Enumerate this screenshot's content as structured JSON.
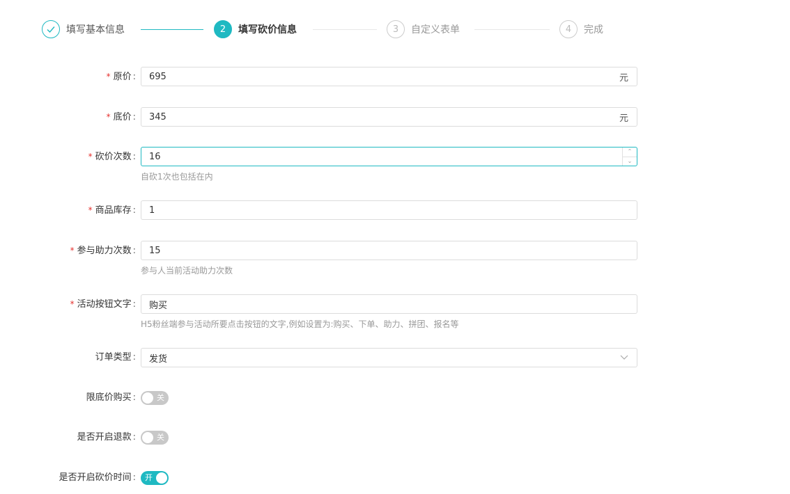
{
  "steps": [
    {
      "index": "",
      "title": "填写基本信息",
      "state": "done",
      "icon": "check-icon"
    },
    {
      "index": "2",
      "title": "填写砍价信息",
      "state": "active"
    },
    {
      "index": "3",
      "title": "自定义表单",
      "state": "pending"
    },
    {
      "index": "4",
      "title": "完成",
      "state": "pending"
    }
  ],
  "form": {
    "colon": ":",
    "required_mark": "*",
    "original_price": {
      "label": "原价",
      "value": "695",
      "suffix": "元"
    },
    "floor_price": {
      "label": "底价",
      "value": "345",
      "suffix": "元"
    },
    "bargain_count": {
      "label": "砍价次数",
      "value": "16",
      "hint": "自砍1次也包括在内"
    },
    "stock": {
      "label": "商品库存",
      "value": "1"
    },
    "help_count": {
      "label": "参与助力次数",
      "value": "15",
      "hint": "参与人当前活动助力次数"
    },
    "button_text": {
      "label": "活动按钮文字",
      "value": "购买",
      "hint": "H5粉丝端参与活动所要点击按钮的文字,例如设置为:购买、下单、助力、拼团、报名等"
    },
    "order_type": {
      "label": "订单类型",
      "value": "发货"
    },
    "limit_floor_buy": {
      "label": "限底价购买",
      "state": "关"
    },
    "enable_refund": {
      "label": "是否开启退款",
      "state": "关"
    },
    "enable_bargain_time": {
      "label": "是否开启砍价时间",
      "state": "开"
    }
  },
  "colors": {
    "accent": "#1fb9c2",
    "required": "#e5312e"
  }
}
